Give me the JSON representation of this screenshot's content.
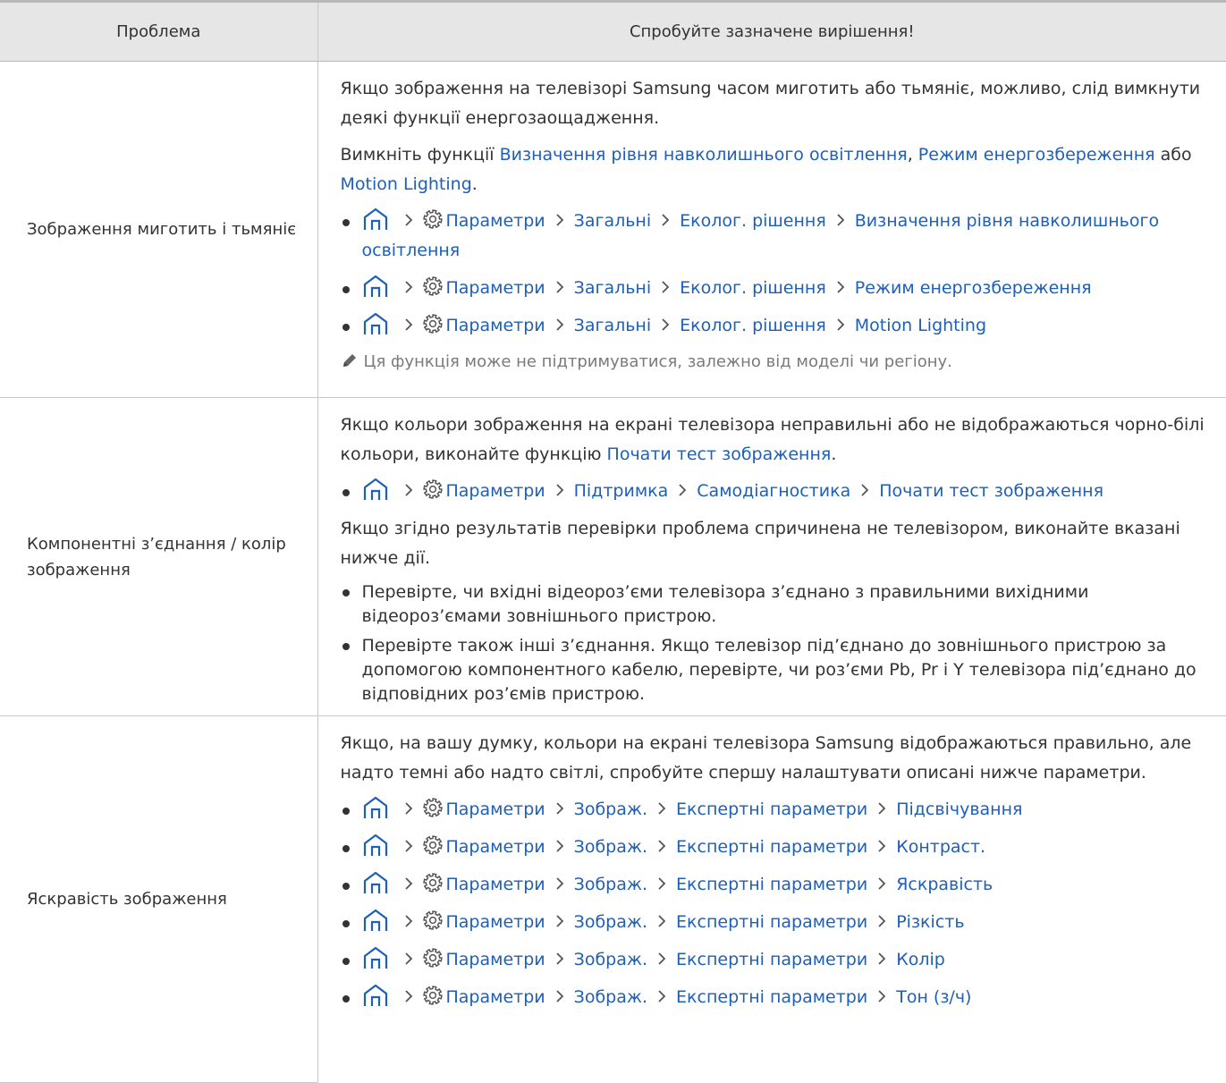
{
  "header": {
    "col_problem": "Проблема",
    "col_solution": "Спробуйте зазначене вирішення!"
  },
  "chevron": "›",
  "rows": {
    "r1": {
      "problem": "Зображення миготить і тьмяніє",
      "p1": "Якщо зображення на телевізорі Samsung часом миготить або тьмяніє, можливо, слід вимкнути деякі функції енергозаощадження.",
      "p2": {
        "t1": "Вимкніть функції ",
        "l1": "Визначення рівня навколишнього освітлення",
        "t2": ", ",
        "l2": "Режим енергозбереження",
        "t3": " або ",
        "l3": "Motion Lighting",
        "t4": "."
      },
      "paths": [
        [
          "Параметри",
          "Загальні",
          "Еколог. рішення",
          "Визначення рівня навколишнього освітлення"
        ],
        [
          "Параметри",
          "Загальні",
          "Еколог. рішення",
          "Режим енергозбереження"
        ],
        [
          "Параметри",
          "Загальні",
          "Еколог. рішення",
          "Motion Lighting"
        ]
      ],
      "note": "Ця функція може не підтримуватися, залежно від моделі чи регіону."
    },
    "r2": {
      "problem": "Компонентні з’єднання / колір зображення",
      "p1": {
        "t1": "Якщо кольори зображення на екрані телевізора неправильні або не відображаються чорно-білі кольори, виконайте функцію ",
        "l1": "Почати тест зображення",
        "t2": "."
      },
      "path": [
        "Параметри",
        "Підтримка",
        "Самодіагностика",
        "Почати тест зображення"
      ],
      "p2": "Якщо згідно результатів перевірки проблема спричинена не телевізором, виконайте вказані нижче дії.",
      "bullets": [
        "Перевірте, чи вхідні відеороз’єми телевізора з’єднано з правильними вихідними відеороз’ємами зовнішнього пристрою.",
        "Перевірте також інші з’єднання. Якщо телевізор під’єднано до зовнішнього пристрою за допомогою компонентного кабелю, перевірте, чи роз’єми Pb, Pr і Y телевізора під’єднано до відповідних роз’ємів пристрою."
      ]
    },
    "r3": {
      "problem": "Яскравість зображення",
      "p1": "Якщо, на вашу думку, кольори на екрані телевізора Samsung відображаються правильно, але надто темні або надто світлі, спробуйте спершу налаштувати описані нижче параметри.",
      "paths": [
        [
          "Параметри",
          "Зображ.",
          "Експертні параметри",
          "Підсвічування"
        ],
        [
          "Параметри",
          "Зображ.",
          "Експертні параметри",
          "Контраст."
        ],
        [
          "Параметри",
          "Зображ.",
          "Експертні параметри",
          "Яскравість"
        ],
        [
          "Параметри",
          "Зображ.",
          "Експертні параметри",
          "Різкість"
        ],
        [
          "Параметри",
          "Зображ.",
          "Експертні параметри",
          "Колір"
        ],
        [
          "Параметри",
          "Зображ.",
          "Експертні параметри",
          "Тон (з/ч)"
        ]
      ]
    }
  },
  "colors": {
    "link": "#1e5fb8",
    "text": "#333333",
    "note": "#7a7a7a",
    "header_bg": "#e6e6e6"
  },
  "icons": {
    "home": "home-icon",
    "settings": "gear-icon",
    "separator": "chevron-right-icon",
    "note": "pencil-icon"
  }
}
